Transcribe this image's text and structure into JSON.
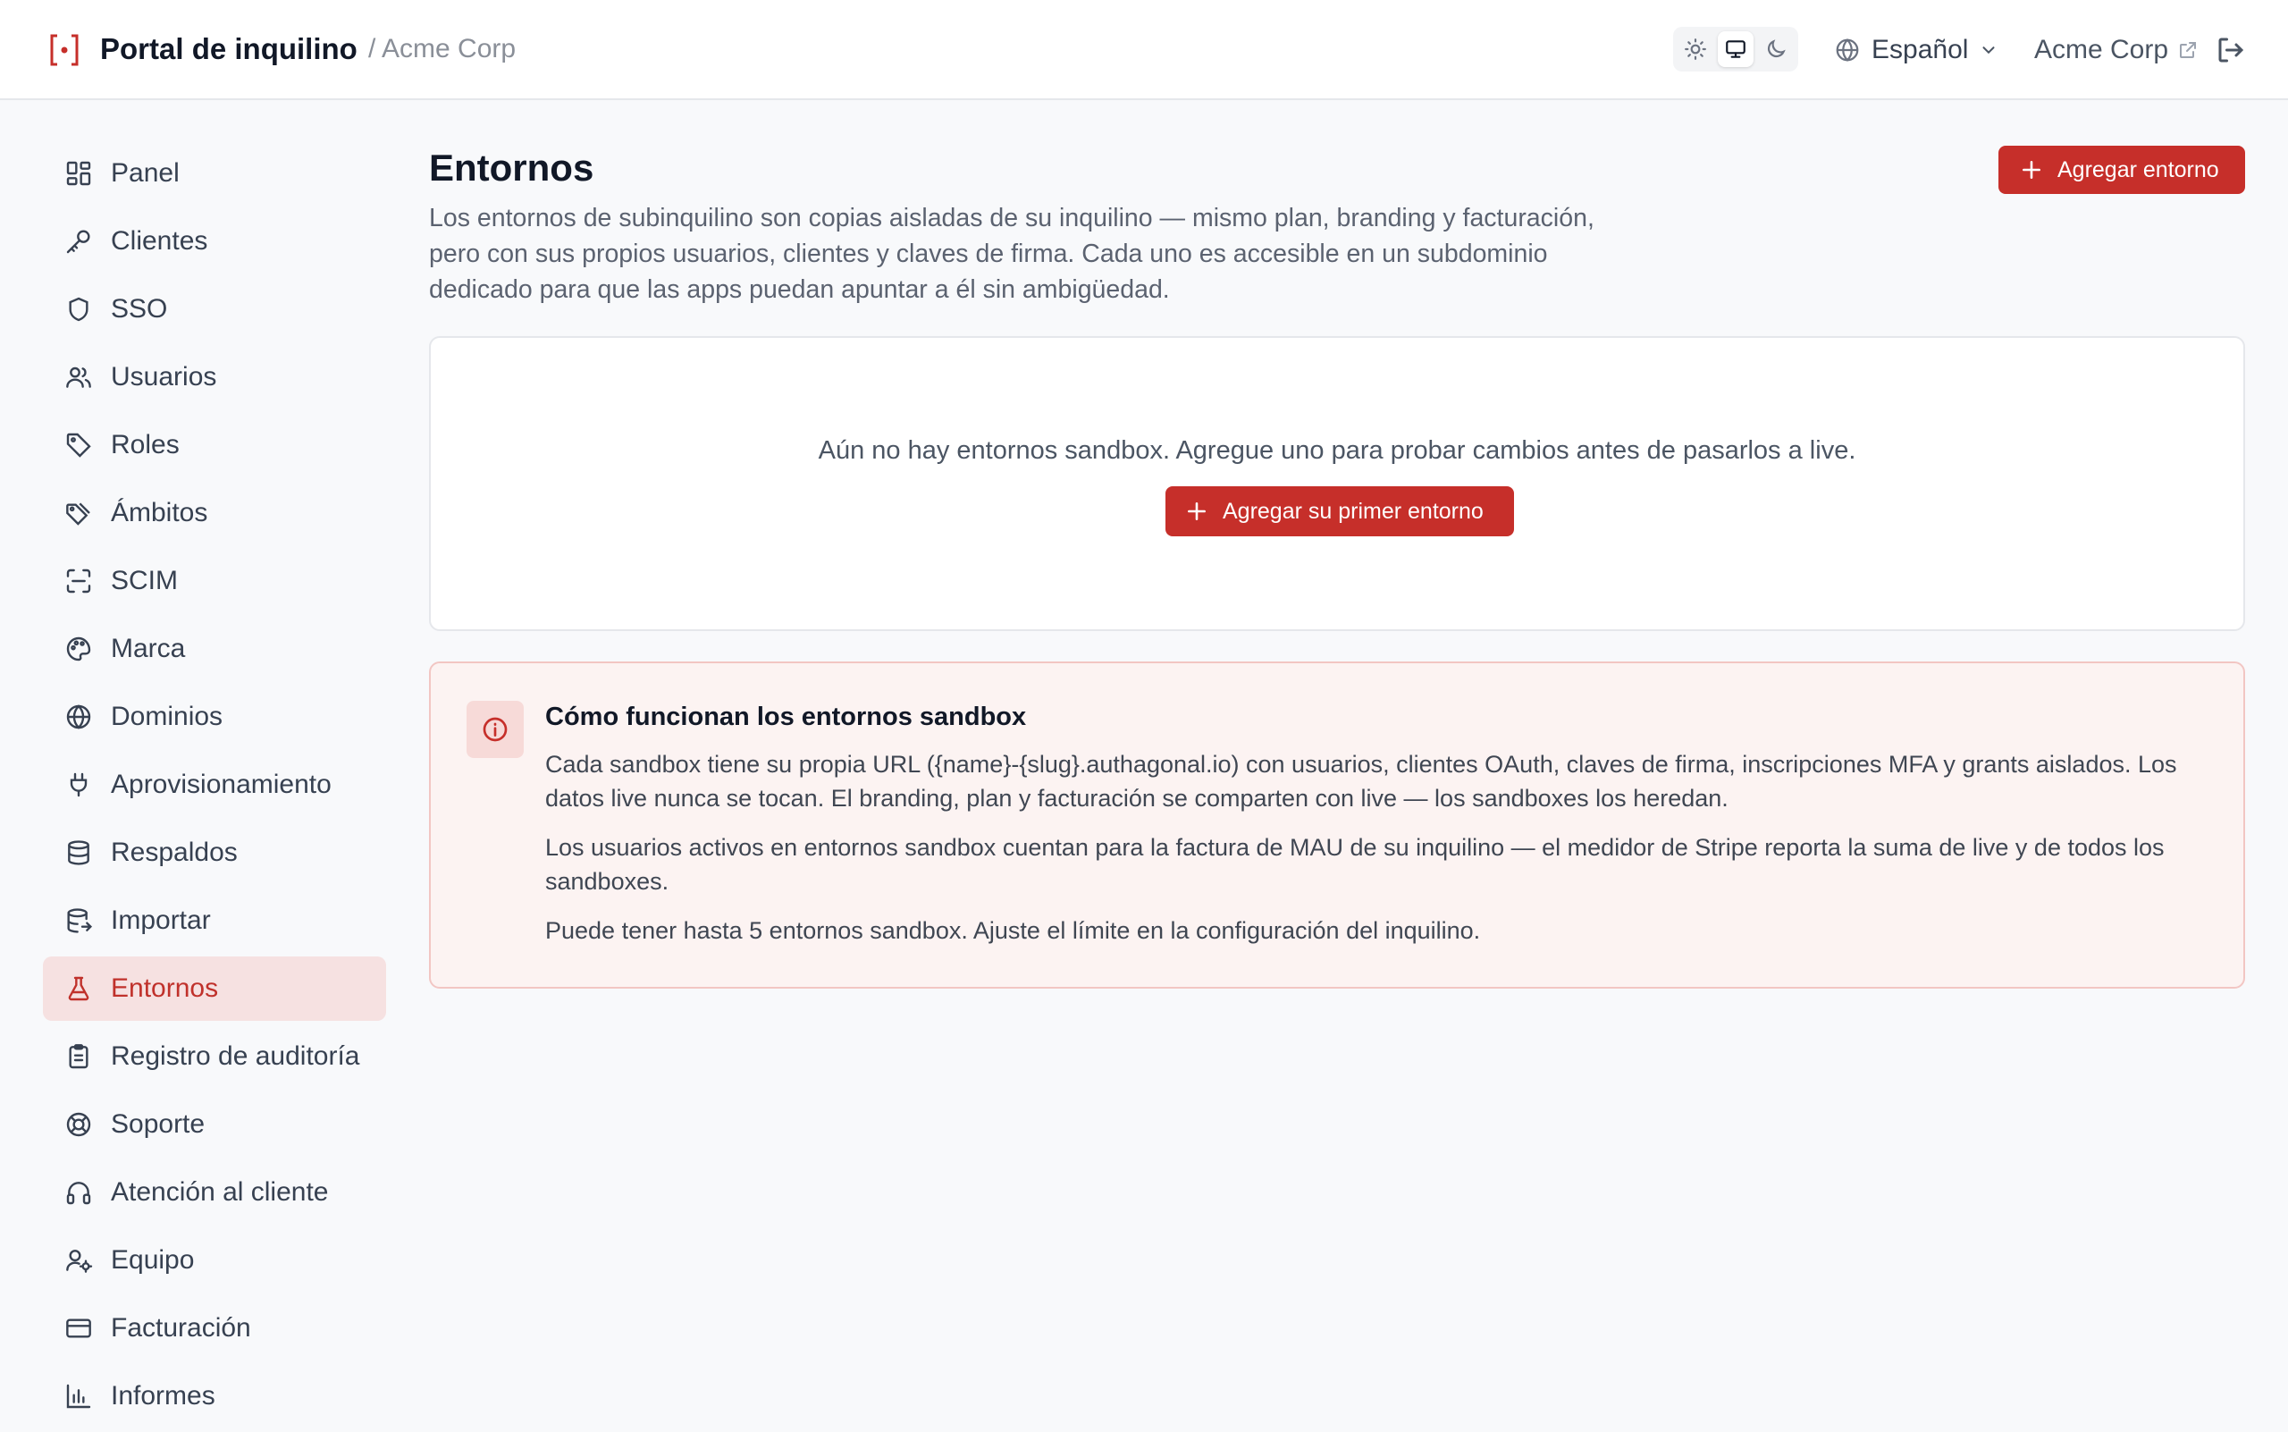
{
  "header": {
    "title": "Portal de inquilino",
    "subtitle": "/ Acme Corp",
    "language": "Español",
    "tenant_link": "Acme Corp",
    "theme_modes": [
      "sun-icon",
      "monitor-icon",
      "moon-icon"
    ],
    "active_theme": "monitor"
  },
  "sidebar": {
    "items": [
      {
        "label": "Panel",
        "icon": "grid-icon"
      },
      {
        "label": "Clientes",
        "icon": "key-icon"
      },
      {
        "label": "SSO",
        "icon": "shield-icon"
      },
      {
        "label": "Usuarios",
        "icon": "users-icon"
      },
      {
        "label": "Roles",
        "icon": "tag-icon"
      },
      {
        "label": "Ámbitos",
        "icon": "tags-icon"
      },
      {
        "label": "SCIM",
        "icon": "scan-icon"
      },
      {
        "label": "Marca",
        "icon": "palette-icon"
      },
      {
        "label": "Dominios",
        "icon": "globe-icon"
      },
      {
        "label": "Aprovisionamiento",
        "icon": "plug-icon"
      },
      {
        "label": "Respaldos",
        "icon": "database-icon"
      },
      {
        "label": "Importar",
        "icon": "database-import-icon"
      },
      {
        "label": "Entornos",
        "icon": "flask-icon",
        "active": true
      },
      {
        "label": "Registro de auditoría",
        "icon": "clipboard-icon"
      },
      {
        "label": "Soporte",
        "icon": "lifebuoy-icon"
      },
      {
        "label": "Atención al cliente",
        "icon": "headphones-icon"
      },
      {
        "label": "Equipo",
        "icon": "user-cog-icon"
      },
      {
        "label": "Facturación",
        "icon": "credit-card-icon"
      },
      {
        "label": "Informes",
        "icon": "bar-chart-icon"
      }
    ]
  },
  "main": {
    "title": "Entornos",
    "description": "Los entornos de subinquilino son copias aisladas de su inquilino — mismo plan, branding y facturación, pero con sus propios usuarios, clientes y claves de firma. Cada uno es accesible en un subdominio dedicado para que las apps puedan apuntar a él sin ambigüedad.",
    "add_button": "Agregar entorno",
    "empty_state": {
      "text": "Aún no hay entornos sandbox. Agregue uno para probar cambios antes de pasarlos a live.",
      "button": "Agregar su primer entorno"
    },
    "info": {
      "title": "Cómo funcionan los entornos sandbox",
      "paragraphs": [
        "Cada sandbox tiene su propia URL ({name}-{slug}.authagonal.io) con usuarios, clientes OAuth, claves de firma, inscripciones MFA y grants aislados. Los datos live nunca se tocan. El branding, plan y facturación se comparten con live — los sandboxes los heredan.",
        "Los usuarios activos en entornos sandbox cuentan para la factura de MAU de su inquilino — el medidor de Stripe reporta la suma de live y de todos los sandboxes.",
        "Puede tener hasta 5 entornos sandbox. Ajuste el límite en la configuración del inquilino."
      ]
    }
  },
  "colors": {
    "accent": "#c62f2a",
    "active_nav_bg": "#f6e1e1",
    "info_bg": "#fcf3f2",
    "info_border": "#f2c6c3"
  }
}
